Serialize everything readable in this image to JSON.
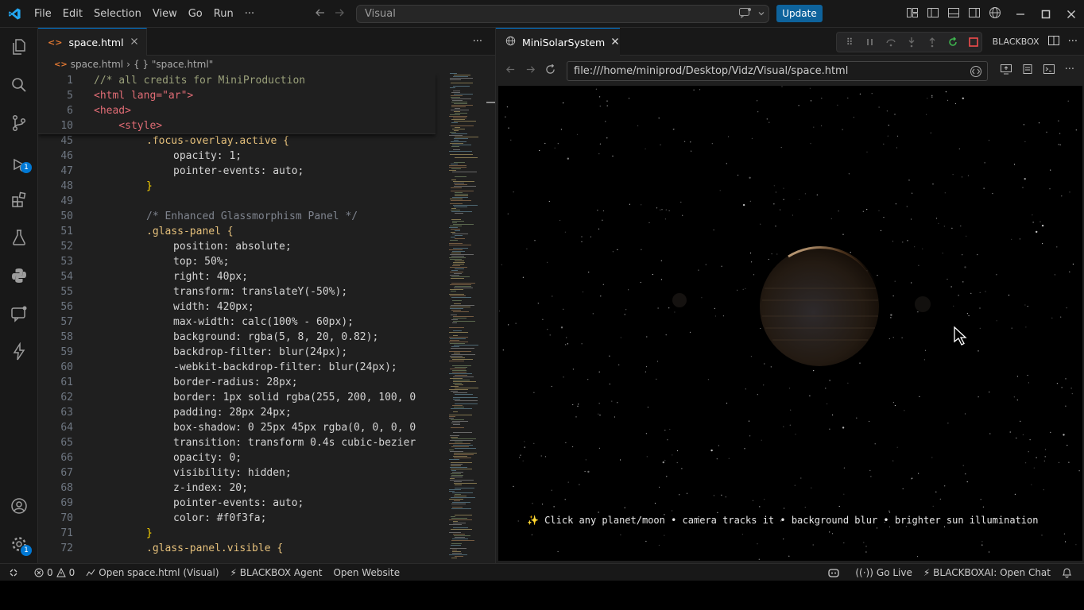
{
  "titlebar": {
    "menu": [
      "File",
      "Edit",
      "Selection",
      "View",
      "Go",
      "Run",
      "···"
    ],
    "command_center": "Visual",
    "update_button": "Update"
  },
  "activity": {
    "run_debug_badge": "1",
    "manage_badge": "1"
  },
  "editor": {
    "tab_label": "space.html",
    "breadcrumb_file": "space.html",
    "breadcrumb_symbol": "{ } \"space.html\"",
    "sticky_lines": [
      {
        "n": "1",
        "text": "//* all credits for MiniProduction"
      },
      {
        "n": "5",
        "text": "<html lang=\"ar\">"
      },
      {
        "n": "6",
        "text": "<head>"
      },
      {
        "n": "10",
        "text": "    <style>"
      }
    ],
    "lines": [
      {
        "n": "45",
        "text": ".focus-overlay.active {"
      },
      {
        "n": "46",
        "text": "opacity: 1;"
      },
      {
        "n": "47",
        "text": "pointer-events: auto;"
      },
      {
        "n": "48",
        "text": "}"
      },
      {
        "n": "49",
        "text": ""
      },
      {
        "n": "50",
        "text": "/* Enhanced Glassmorphism Panel */"
      },
      {
        "n": "51",
        "text": ".glass-panel {"
      },
      {
        "n": "52",
        "text": "position: absolute;"
      },
      {
        "n": "53",
        "text": "top: 50%;"
      },
      {
        "n": "54",
        "text": "right: 40px;"
      },
      {
        "n": "55",
        "text": "transform: translateY(-50%);"
      },
      {
        "n": "56",
        "text": "width: 420px;"
      },
      {
        "n": "57",
        "text": "max-width: calc(100% - 60px);"
      },
      {
        "n": "58",
        "text": "background: rgba(5, 8, 20, 0.82);"
      },
      {
        "n": "59",
        "text": "backdrop-filter: blur(24px);"
      },
      {
        "n": "60",
        "text": "-webkit-backdrop-filter: blur(24px);"
      },
      {
        "n": "61",
        "text": "border-radius: 28px;"
      },
      {
        "n": "62",
        "text": "border: 1px solid rgba(255, 200, 100, 0"
      },
      {
        "n": "63",
        "text": "padding: 28px 24px;"
      },
      {
        "n": "64",
        "text": "box-shadow: 0 25px 45px rgba(0, 0, 0, 0"
      },
      {
        "n": "65",
        "text": "transition: transform 0.4s cubic-bezier"
      },
      {
        "n": "66",
        "text": "opacity: 0;"
      },
      {
        "n": "67",
        "text": "visibility: hidden;"
      },
      {
        "n": "68",
        "text": "z-index: 20;"
      },
      {
        "n": "69",
        "text": "pointer-events: auto;"
      },
      {
        "n": "70",
        "text": "color: #f0f3fa;"
      },
      {
        "n": "71",
        "text": "}"
      },
      {
        "n": "72",
        "text": ".glass-panel.visible {"
      }
    ]
  },
  "browser": {
    "tab_label": "MiniSolarSystem",
    "blackbox_label": "BLACKBOX",
    "url": "file:///home/miniprod/Desktop/Vidz/Visual/space.html",
    "hint": "✨ Click any planet/moon • camera tracks it • background blur • brighter sun illumination"
  },
  "statusbar": {
    "errors": "0",
    "warnings": "0",
    "open_in": "Open space.html (Visual)",
    "agent": "⚡ BLACKBOX Agent",
    "open_website": "Open Website",
    "go_live": "Go Live",
    "chat": "⚡ BLACKBOXAI: Open Chat"
  },
  "colors": {
    "accent": "#0078d4",
    "update_button": "#0e639c"
  }
}
